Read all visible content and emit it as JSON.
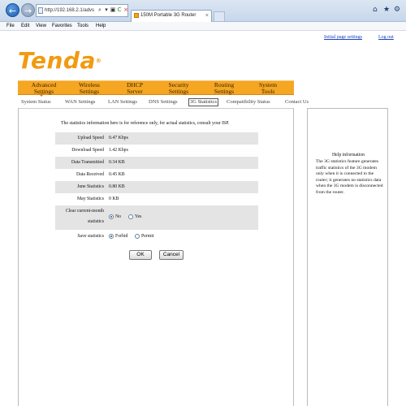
{
  "browser": {
    "back_glyph": "←",
    "forward_glyph": "→",
    "address": "http://192.168.2.1/advs",
    "addr_search": "⌕",
    "addr_dropdown": "▾",
    "addr_compat": "▣",
    "addr_refresh": "C",
    "addr_stop": "×",
    "tab_title": "150M Portable 3G Router",
    "tab_close": "×",
    "home_glyph": "⌂",
    "fav_glyph": "★",
    "tools_glyph": "⚙"
  },
  "menubar": [
    "File",
    "Edit",
    "View",
    "Favorites",
    "Tools",
    "Help"
  ],
  "toplinks": {
    "wizard": "Initial page settings",
    "logout": "Log out"
  },
  "logo": {
    "text": "Tenda",
    "reg": "®"
  },
  "nav": [
    {
      "label": "Advanced Settings"
    },
    {
      "label": "Wireless Settings"
    },
    {
      "label": "DHCP Server"
    },
    {
      "label": "Security Settings"
    },
    {
      "label": "Routing Settings"
    },
    {
      "label": "System Tools"
    }
  ],
  "subnav": [
    "System Status",
    "WAN Settings",
    "LAN Settings",
    "DNS Settings",
    "3G Statistics",
    "Compatibility Status",
    "Contact Us"
  ],
  "content": {
    "intro": "The statistics information here is for reference only, for actual statistics, consult your ISP.",
    "rows": [
      {
        "label": "Upload Speed",
        "value": "0.47 Kbps"
      },
      {
        "label": "Download Speed",
        "value": "1.42 Kbps"
      },
      {
        "label": "Data Transmitted",
        "value": "0.34 KB"
      },
      {
        "label": "Data Received",
        "value": "0.45 KB"
      },
      {
        "label": "June Statistics",
        "value": "0.80 KB"
      },
      {
        "label": "May Statistics",
        "value": "0 KB"
      }
    ],
    "clear": {
      "label_line1": "Clear current-month",
      "label_line2": "statistics",
      "opt_no": "No",
      "opt_yes": "Yes"
    },
    "save": {
      "label": "Save statistics",
      "opt_forbid": "Forbid",
      "opt_permit": "Permit"
    },
    "ok_label": "OK",
    "cancel_label": "Cancel"
  },
  "help": {
    "title": "Help information",
    "text": "The 3G statistics feature generates traffic statistics of the 3G modem only when it is connected to the router; it generates no statistics data when the 3G modem is disconnected from the router."
  }
}
